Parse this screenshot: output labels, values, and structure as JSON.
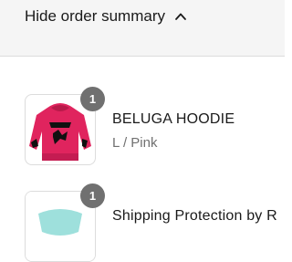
{
  "order_summary": {
    "toggle_label": "Hide order summary",
    "toggle_icon": "chevron-up-icon"
  },
  "items": [
    {
      "name": "BELUGA HOODIE",
      "variant": "L / Pink",
      "quantity": "1",
      "thumbnail": "pink-hoodie-image"
    },
    {
      "name": "Shipping Protection by R",
      "quantity": "1",
      "thumbnail": "shipping-protection-image"
    }
  ],
  "colors": {
    "header_bg": "#f5f5f5",
    "badge_bg": "#707070",
    "hoodie_pink": "#e0245e",
    "protection_teal": "#9ee0dc"
  }
}
